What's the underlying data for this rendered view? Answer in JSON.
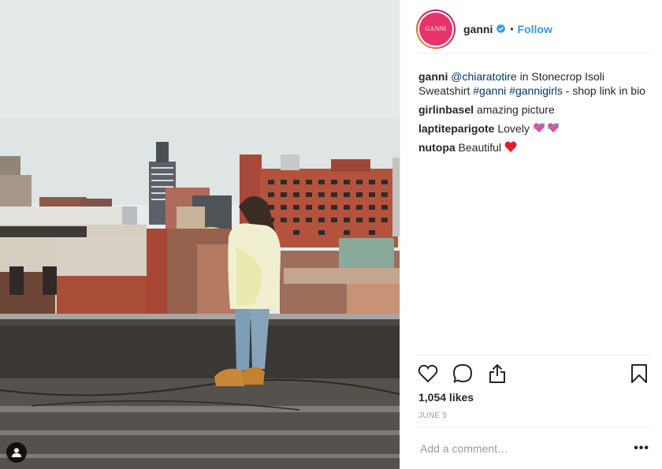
{
  "colors": {
    "link_blue": "#3897f0",
    "hashtag_blue": "#003569",
    "brand_pink": "#e8336d",
    "border": "#efefef",
    "muted": "#999999"
  },
  "post": {
    "image_alt": "Woman in a yellow sweatshirt standing on a rooftop overlooking city buildings",
    "tag_icon": "user-tag-icon"
  },
  "header": {
    "avatar_text": "GANNI",
    "username": "ganni",
    "verified_icon": "verified-badge-icon",
    "separator": "•",
    "follow_label": "Follow"
  },
  "comments": [
    {
      "user": "ganni",
      "parts": [
        {
          "type": "mention",
          "text": "@chiaratotire"
        },
        {
          "type": "text",
          "text": " in Stonecrop Isoli Sweatshirt "
        },
        {
          "type": "hashtag",
          "text": "#ganni"
        },
        {
          "type": "text",
          "text": " "
        },
        {
          "type": "hashtag",
          "text": "#gannigirls"
        },
        {
          "type": "text",
          "text": " - shop link in bio"
        }
      ]
    },
    {
      "user": "girlinbasel",
      "text": "amazing picture"
    },
    {
      "user": "laptiteparigote",
      "text": "Lovely",
      "emoji": "two-hearts-emoji"
    },
    {
      "user": "nutopa",
      "text": "Beautiful",
      "emoji": "red-heart-emoji"
    }
  ],
  "actions": {
    "like_icon": "heart-icon",
    "comment_icon": "comment-bubble-icon",
    "share_icon": "share-icon",
    "save_icon": "bookmark-icon"
  },
  "likes": "1,054 likes",
  "date": "JUNE 5",
  "comment_box": {
    "placeholder": "Add a comment…",
    "more_label": "•••"
  }
}
